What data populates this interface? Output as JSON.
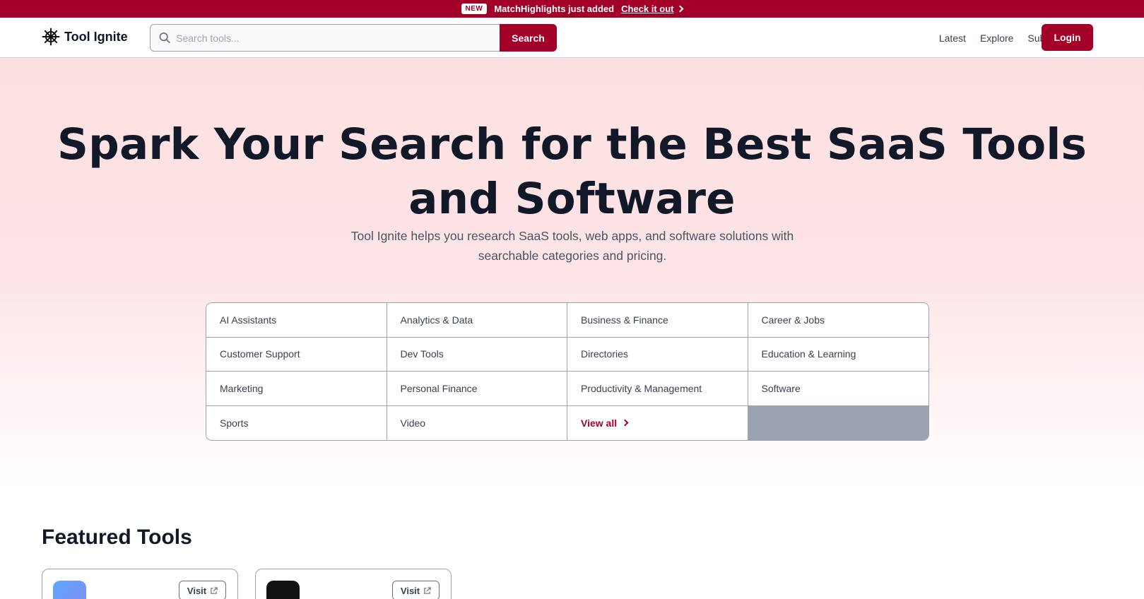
{
  "announcement": {
    "badge": "NEW",
    "message": "MatchHighlights just added",
    "link_label": "Check it out"
  },
  "header": {
    "brand": "Tool Ignite",
    "search_placeholder": "Search tools...",
    "search_button": "Search",
    "nav": [
      "Latest",
      "Explore",
      "Submit"
    ],
    "login": "Login"
  },
  "hero": {
    "title": "Spark Your Search for the Best SaaS Tools and Software",
    "subtitle": "Tool Ignite helps you research SaaS tools, web apps, and software solutions with searchable categories and pricing."
  },
  "categories": [
    "AI Assistants",
    "Analytics & Data",
    "Business & Finance",
    "Career & Jobs",
    "Customer Support",
    "Dev Tools",
    "Directories",
    "Education & Learning",
    "Marketing",
    "Personal Finance",
    "Productivity & Management",
    "Software",
    "Sports",
    "Video"
  ],
  "view_all_label": "View all",
  "featured": {
    "title": "Featured Tools",
    "visit_label": "Visit"
  },
  "colors": {
    "brand": "#a30029",
    "hero_bg": "#fde0e2"
  }
}
